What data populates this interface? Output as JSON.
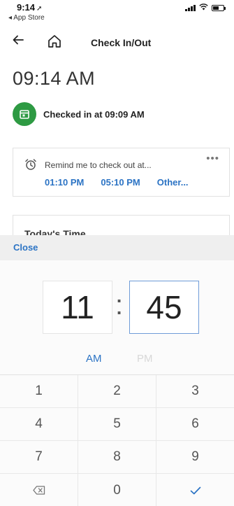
{
  "status": {
    "time": "9:14",
    "back_app": "◂ App Store"
  },
  "nav": {
    "title": "Check In/Out"
  },
  "clock": "09:14 AM",
  "checked_in": "Checked in at 09:09 AM",
  "reminder": {
    "message": "Remind me to check out at...",
    "options": [
      "01:10 PM",
      "05:10 PM",
      "Other..."
    ]
  },
  "todays_time": "Today's Time",
  "picker": {
    "close_label": "Close",
    "hours": "11",
    "minutes": "45",
    "separator": ":",
    "am": "AM",
    "pm": "PM"
  },
  "keypad": {
    "keys": [
      "1",
      "2",
      "3",
      "4",
      "5",
      "6",
      "7",
      "8",
      "9"
    ],
    "zero": "0"
  },
  "colors": {
    "accent": "#2b73c4",
    "checked_green": "#2e9a43"
  },
  "icons": [
    "location-arrow-icon",
    "signal-icon",
    "wifi-icon",
    "battery-icon",
    "back-arrow-icon",
    "home-icon",
    "calendar-check-icon",
    "alarm-clock-icon",
    "more-icon",
    "backspace-icon",
    "checkmark-icon"
  ]
}
